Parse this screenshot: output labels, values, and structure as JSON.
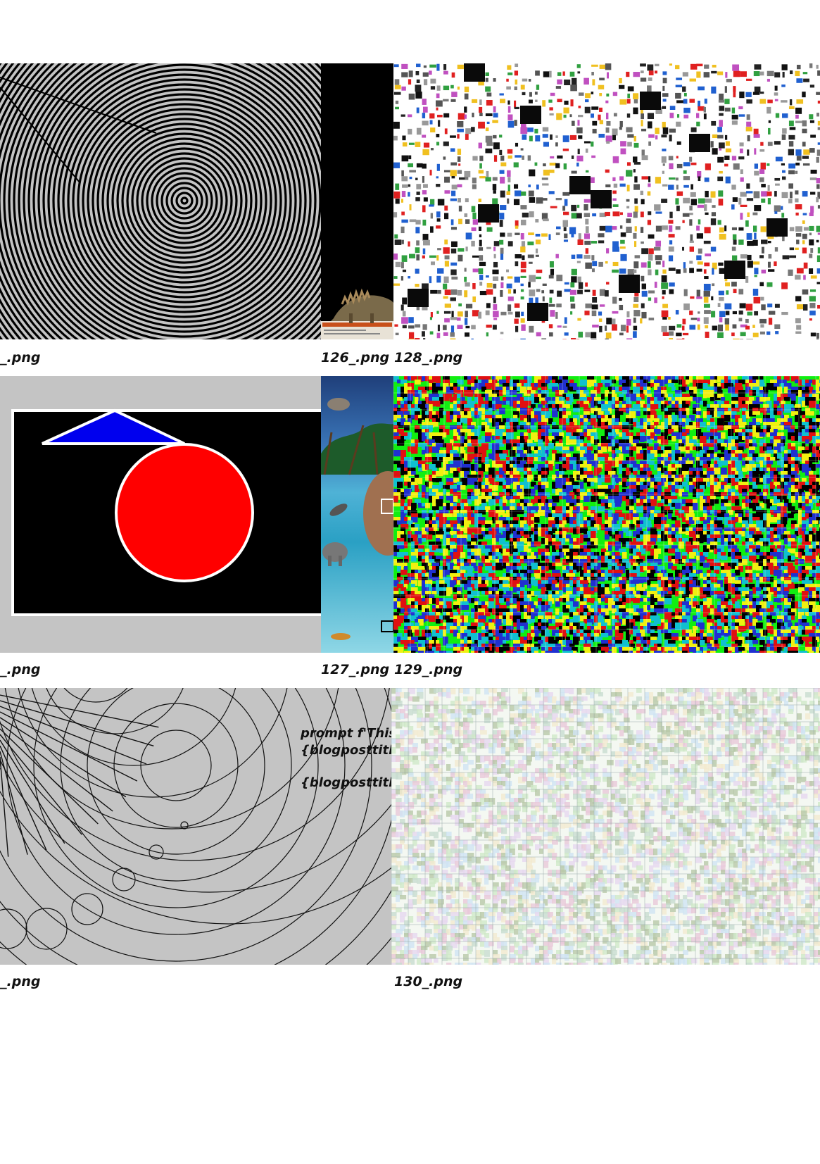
{
  "gallery": {
    "captions": {
      "row1_left": "_.png",
      "row1_mid": "126_.png",
      "row1_right": "128_.png",
      "row2_left": "_.png",
      "row2_mid": "127_.png",
      "row2_right": "129_.png",
      "row3_left": "_.png",
      "row3_right": "130_.png"
    },
    "prompt_overlay": {
      "line1": "prompt  f'This",
      "line2": "{blogposttitle}",
      "line3": "{blogposttitle}"
    }
  },
  "colors": {
    "tile_gray": "#c4c4c4",
    "shape_red": "#ff0000",
    "shape_blue": "#0000ee",
    "noise_green": "#11ee11"
  }
}
